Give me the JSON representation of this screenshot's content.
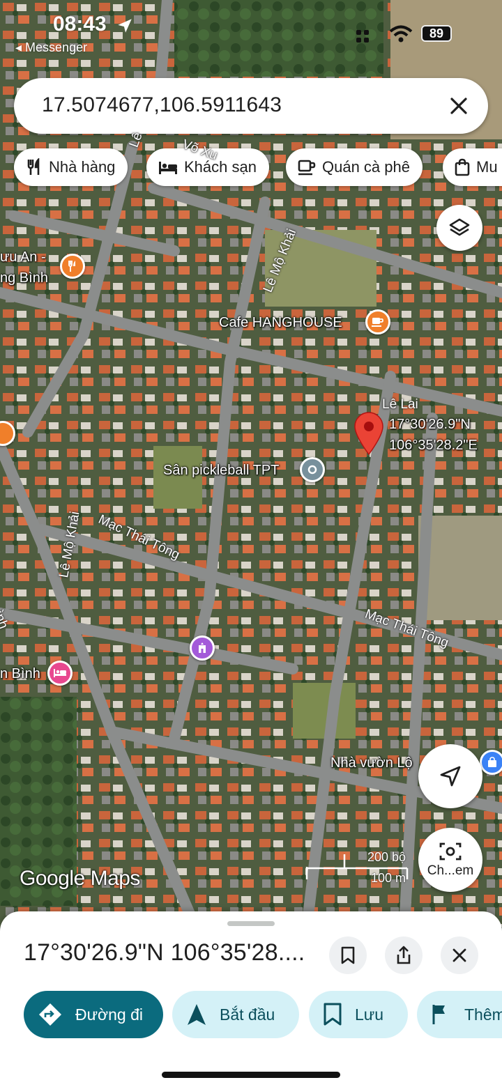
{
  "status_bar": {
    "time": "08:43",
    "back_app": "◂ Messenger",
    "battery": "89"
  },
  "search": {
    "query": "17.5074677,106.5911643"
  },
  "chips": [
    {
      "label": "Nhà hàng",
      "icon": "restaurant-icon"
    },
    {
      "label": "Khách sạn",
      "icon": "hotel-icon"
    },
    {
      "label": "Quán cà phê",
      "icon": "coffee-icon"
    },
    {
      "label": "Mu",
      "icon": "shopping-bag-icon"
    }
  ],
  "map": {
    "places": {
      "cafe": "Cafe HANGHOUSE",
      "pickleball": "Sân pickleball TPT",
      "restaurant_partial": "ưu An -",
      "restaurant_partial2": "ng Bình",
      "hotel_partial": "n Bình",
      "garden_partial": "Nhà vườn Lộ",
      "inh_partial": "ình"
    },
    "streets": {
      "le_mo_khai_1": "Lê Mộ Khải",
      "le_mo_khai_2": "Lê Mộ Khải",
      "mac_thai_tong_1": "Mạc Thái Tông",
      "mac_thai_tong_2": "Mạc Thái Tông",
      "le_lai": "Lê Lai",
      "vo_xu": "Võ Xu",
      "top_left_frag": "Lê"
    },
    "pin": {
      "lat": "17°30'26.9\"N",
      "lng": "106°35'28.2\"E",
      "color": "#ea4335"
    },
    "scale": {
      "imperial": "200 bộ",
      "metric": "100 m"
    },
    "logo": "Google Maps",
    "camera_label": "Ch...em"
  },
  "sheet": {
    "title": "17°30'26.9\"N 106°35'28....",
    "actions": [
      {
        "label": "Đường đi",
        "icon": "directions-icon",
        "primary": true
      },
      {
        "label": "Bắt đầu",
        "icon": "navigation-arrow-icon"
      },
      {
        "label": "Lưu",
        "icon": "bookmark-icon"
      },
      {
        "label": "Thêm",
        "icon": "flag-icon"
      }
    ]
  },
  "colors": {
    "primary": "#0b6b7e",
    "secondary_bg": "#d4f1f7",
    "pin": "#ea4335",
    "cafe": "#f07f2a",
    "pickleball": "#78909c",
    "hotel": "#e8488f",
    "landmark": "#a35ad9"
  }
}
